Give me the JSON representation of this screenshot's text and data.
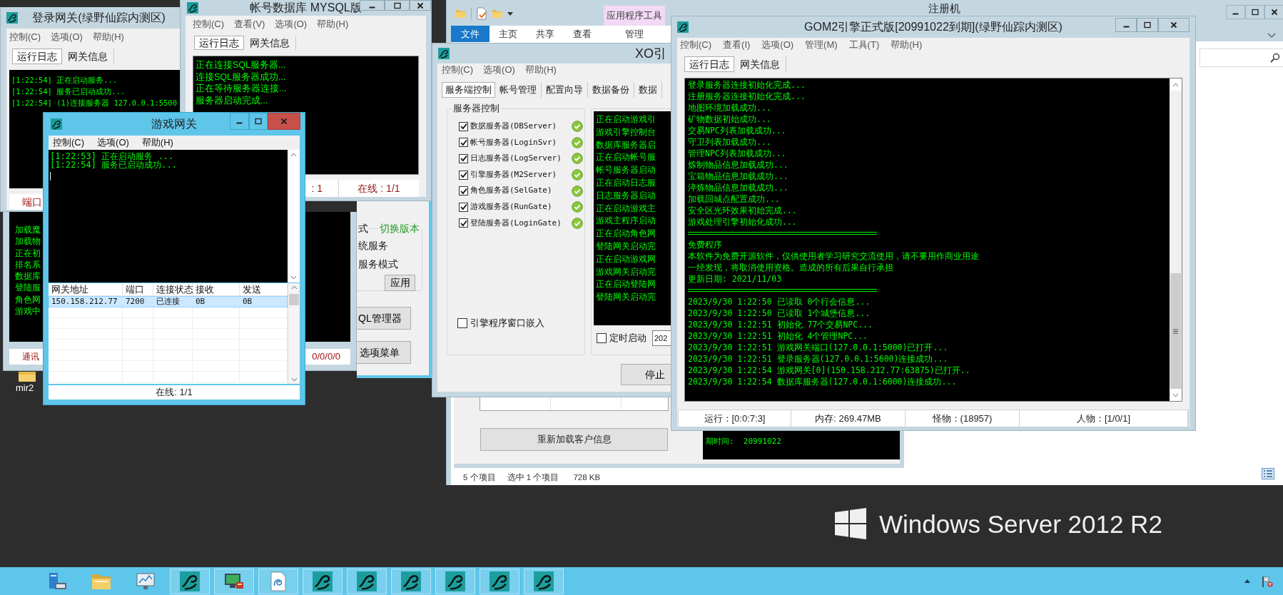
{
  "explorer": {
    "title": "注册机",
    "context_tab": "应用程序工具",
    "ribbon_tabs": [
      {
        "label": "文件",
        "selected": true
      },
      {
        "label": "主页",
        "selected": false
      },
      {
        "label": "共享",
        "selected": false
      },
      {
        "label": "查看",
        "selected": false
      },
      {
        "label": "管理",
        "selected": false
      }
    ],
    "status": {
      "item_count": "5 个项目",
      "selection": "选中 1 个项目",
      "size": "728 KB"
    }
  },
  "registration_tool": {
    "button": "重新加载客户信息",
    "log_line": "期时间:  20991022"
  },
  "launcher": {
    "group_label": "式",
    "switch_version": "切换版本",
    "options": [
      "统服务",
      "服务模式"
    ],
    "apply_button": "应用",
    "buttons": [
      "QL管理器",
      "选项菜单"
    ]
  },
  "db_server": {
    "log_lines": [
      "加载魔",
      "加载物",
      "正在初",
      "排名系",
      "数据库",
      "登陆服",
      "角色网",
      "游戏中"
    ],
    "status": [
      "通讯",
      "0/0/0/0"
    ]
  },
  "login_gate": {
    "title": "登录网关(绿野仙踪内测区)",
    "menu": [
      "控制(C)",
      "选项(O)",
      "帮助(H)"
    ],
    "tabs": [
      {
        "label": "运行日志",
        "selected": true
      },
      {
        "label": "网关信息",
        "selected": false
      }
    ],
    "log_lines": [
      "[1:22:54] 正在启动服务...",
      "[1:22:54] 服务已启动成功...",
      "[1:22:54] (1)连接服务器 127.0.0.1:5500"
    ],
    "status": [
      "端口"
    ]
  },
  "account_db": {
    "title": "帐号数据库 MYSQL版",
    "menu": [
      "控制(C)",
      "查看(V)",
      "选项(O)",
      "帮助(H)"
    ],
    "tabs": [
      {
        "label": "运行日志",
        "selected": true
      },
      {
        "label": "网关信息",
        "selected": false
      }
    ],
    "log_lines": [
      "正在连接SQL服务器...",
      "连接SQL服务器成功...",
      "正在等待服务器连接...",
      "服务器启动完成..."
    ],
    "status": [
      ": 1",
      "在线 : 1/1"
    ]
  },
  "game_gate": {
    "title": "游戏网关",
    "menu": [
      "控制(C)",
      "选项(O)",
      "帮助(H)"
    ],
    "log_lines": [
      "[1:22:53] 正在启动服务 ...",
      "[1:22:54] 服务已启动成功..."
    ],
    "table": {
      "columns": [
        "网关地址",
        "端口",
        "连接状态",
        "接收",
        "发送"
      ],
      "rows": [
        {
          "cells": [
            "150.158.212.77",
            "7200",
            "已连接",
            "0B",
            "0B"
          ],
          "selected": true
        }
      ]
    },
    "status": "在线: 1/1"
  },
  "xo_engine": {
    "title": "XO引",
    "menu": [
      "控制(C)",
      "选项(O)",
      "帮助(H)"
    ],
    "tabs": [
      {
        "label": "服务端控制",
        "selected": true
      },
      {
        "label": "帐号管理",
        "selected": false
      },
      {
        "label": "配置向导",
        "selected": false
      },
      {
        "label": "数据备份",
        "selected": false
      },
      {
        "label": "数据",
        "selected": false
      }
    ],
    "group_title": "服务器控制",
    "servers": [
      {
        "label": "数据服务器(DBServer)",
        "checked": true,
        "running": true
      },
      {
        "label": "帐号服务器(LoginSvr)",
        "checked": true,
        "running": true
      },
      {
        "label": "日志服务器(LogServer)",
        "checked": true,
        "running": true
      },
      {
        "label": "引擎服务器(M2Server)",
        "checked": true,
        "running": true
      },
      {
        "label": "角色服务器(SelGate)",
        "checked": true,
        "running": true
      },
      {
        "label": "游戏服务器(RunGate)",
        "checked": true,
        "running": true
      },
      {
        "label": "登陆服务器(LoginGate)",
        "checked": true,
        "running": true
      }
    ],
    "embed_option": {
      "label": "引擎程序窗口嵌入",
      "checked": false
    },
    "log_lines": [
      "正在启动游戏引",
      "游戏引擎控制台",
      "数据库服务器启",
      "正在启动帐号服",
      "帐号服务器启动",
      "正在启动日志服",
      "日志服务器启动",
      "正在启动游戏主",
      "游戏主程序启动",
      "正在启动角色网",
      "登陆网关启动完",
      "正在启动游戏网",
      "游戏网关启动完",
      "正在启动登陆网",
      "登陆网关启动完"
    ],
    "timer_option": {
      "label": "定时启动",
      "checked": false
    },
    "timer_value": "202",
    "stop_button": "停止"
  },
  "gom2": {
    "title": "GOM2引擎正式版[20991022到期](绿野仙踪内测区)",
    "menu": [
      "控制(C)",
      "查看(I)",
      "选项(O)",
      "管理(M)",
      "工具(T)",
      "帮助(H)"
    ],
    "tabs": [
      {
        "label": "运行日志",
        "selected": true
      },
      {
        "label": "网关信息",
        "selected": false
      }
    ],
    "log": [
      {
        "kind": "line",
        "text": "登录服务器连接初始化完成..."
      },
      {
        "kind": "line",
        "text": "注册服务器连接初始化完成..."
      },
      {
        "kind": "line",
        "text": "地图环境加载成功..."
      },
      {
        "kind": "line",
        "text": "矿物数据初始成功..."
      },
      {
        "kind": "line",
        "text": "交易NPC列表加载成功..."
      },
      {
        "kind": "line",
        "text": "守卫列表加载成功..."
      },
      {
        "kind": "line",
        "text": "管理NPC列表加载成功..."
      },
      {
        "kind": "line",
        "text": "炼制物品信息加载成功..."
      },
      {
        "kind": "line",
        "text": "宝箱物品信息加载成功..."
      },
      {
        "kind": "line",
        "text": "淬炼物品信息加载成功..."
      },
      {
        "kind": "line",
        "text": "加载回城点配置成功..."
      },
      {
        "kind": "line",
        "text": "安全区光环效果初始完成..."
      },
      {
        "kind": "line",
        "text": "游戏处理引擎初始化成功..."
      },
      {
        "kind": "separator"
      },
      {
        "kind": "line",
        "text": "免费程序"
      },
      {
        "kind": "line",
        "text": "本软件为免费开源软件，仅供使用者学习研究交流使用，请不要用作商业用途"
      },
      {
        "kind": "line",
        "text": "一经发现，将取消使用资格。造成的所有后果自行承担"
      },
      {
        "kind": "line",
        "text": "更新日期: 2021/11/03"
      },
      {
        "kind": "separator"
      },
      {
        "kind": "line",
        "text": "2023/9/30 1:22:50 已读取 0个行会信息..."
      },
      {
        "kind": "line",
        "text": "2023/9/30 1:22:50 已读取 1个城堡信息..."
      },
      {
        "kind": "line",
        "text": "2023/9/30 1:22:51 初始化 77个交易NPC..."
      },
      {
        "kind": "line",
        "text": "2023/9/30 1:22:51 初始化 4个管理NPC..."
      },
      {
        "kind": "line",
        "text": "2023/9/30 1:22:51 游戏网关端口(127.0.0.1:5000)已打开..."
      },
      {
        "kind": "line",
        "text": "2023/9/30 1:22:51 登录服务器(127.0.0.1:5600)连接成功..."
      },
      {
        "kind": "line",
        "text": "2023/9/30 1:22:54 游戏网关[0](150.158.212.77:63875)已打开.."
      },
      {
        "kind": "line",
        "text": "2023/9/30 1:22:54 数据库服务器(127.0.0.1:6000)连接成功..."
      }
    ],
    "status": [
      "运行：[0:0:7:3]",
      "内存: 269.47MB",
      "怪物：(18957)",
      "人物：[1/0/1]"
    ]
  },
  "desktop_icons": [
    {
      "label": "mir2"
    }
  ],
  "os_logo": "Windows Server 2012 R2",
  "taskbar": {
    "items": [
      {
        "kind": "server",
        "running": false
      },
      {
        "kind": "folder",
        "running": false
      },
      {
        "kind": "monitor",
        "running": false
      },
      {
        "kind": "app",
        "running": true
      },
      {
        "kind": "computer",
        "running": true
      },
      {
        "kind": "document",
        "running": true
      },
      {
        "kind": "app",
        "running": true
      },
      {
        "kind": "app",
        "running": true
      },
      {
        "kind": "app",
        "running": true
      },
      {
        "kind": "app",
        "running": true
      },
      {
        "kind": "app",
        "running": true
      },
      {
        "kind": "app",
        "running": true
      }
    ]
  }
}
